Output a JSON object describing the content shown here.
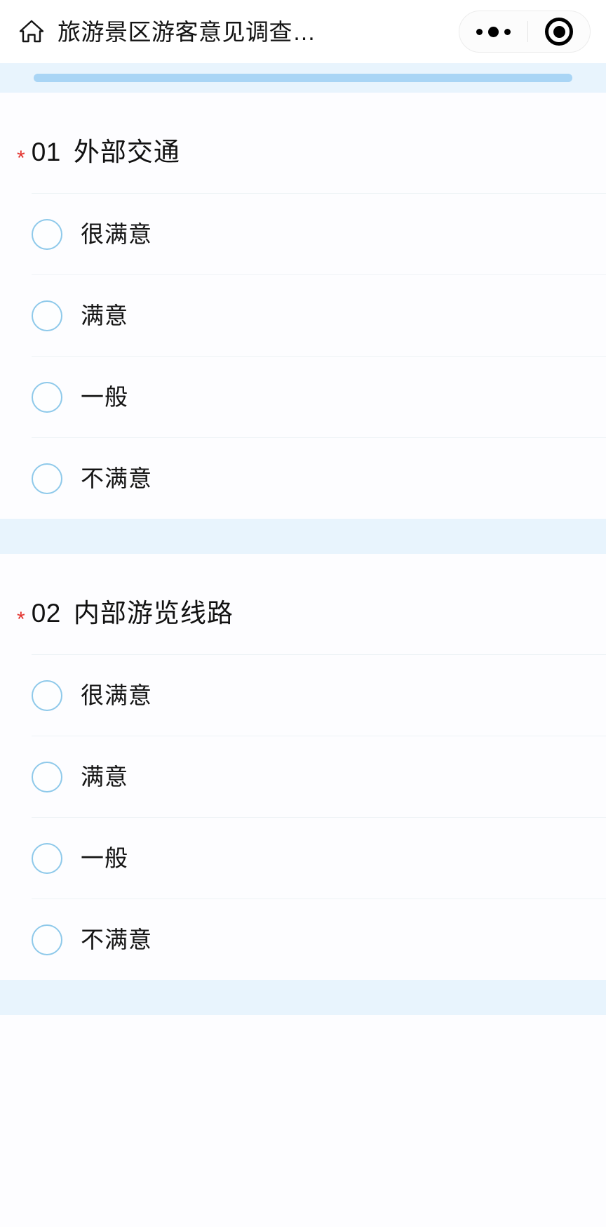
{
  "header": {
    "home_icon": "home-icon",
    "title": "旅游景区游客意见调查…",
    "more_icon": "more-dots-icon",
    "target_icon": "target-circle-icon"
  },
  "progress": {
    "percent": 100
  },
  "questions": [
    {
      "required_mark": "*",
      "number": "01",
      "text": "外部交通",
      "options": [
        {
          "label": "很满意",
          "selected": false
        },
        {
          "label": "满意",
          "selected": false
        },
        {
          "label": "一般",
          "selected": false
        },
        {
          "label": "不满意",
          "selected": false
        }
      ]
    },
    {
      "required_mark": "*",
      "number": "02",
      "text": "内部游览线路",
      "options": [
        {
          "label": "很满意",
          "selected": false
        },
        {
          "label": "满意",
          "selected": false
        },
        {
          "label": "一般",
          "selected": false
        },
        {
          "label": "不满意",
          "selected": false
        }
      ]
    }
  ],
  "colors": {
    "accent": "#a9d5f5",
    "band": "#e8f4fd",
    "radio_border": "#8ec9ea",
    "required": "#e3342f",
    "divider": "#eef3f6",
    "background": "#fdfdff"
  }
}
